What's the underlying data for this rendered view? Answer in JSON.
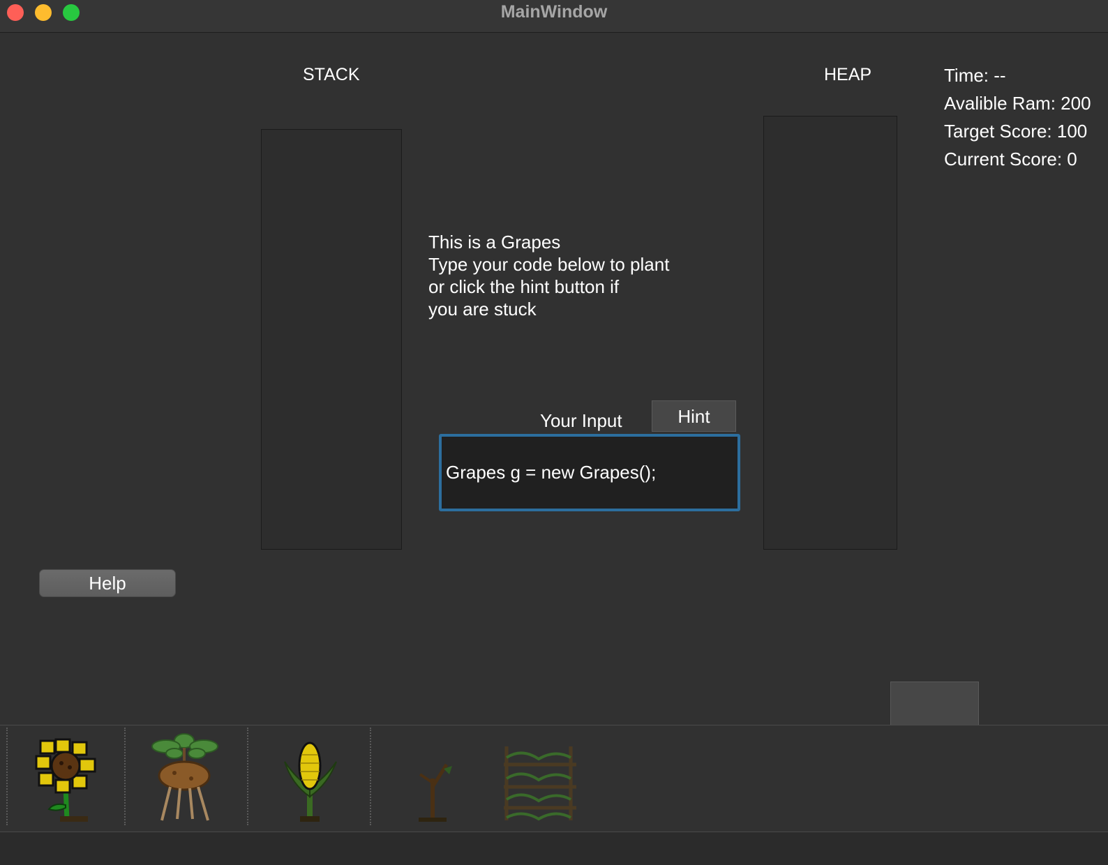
{
  "window": {
    "title": "MainWindow"
  },
  "labels": {
    "stack": "STACK",
    "heap": "HEAP",
    "your_input": "Your Input"
  },
  "stats": {
    "time": "Time: --",
    "ram": "Avalible Ram: 200",
    "target": "Target Score: 100",
    "current": "Current Score: 0"
  },
  "message": {
    "lines": [
      "This is a Grapes",
      "Type your code below to plant",
      "or click the hint button if",
      "you are stuck"
    ]
  },
  "buttons": {
    "hint": "Hint",
    "help": "Help"
  },
  "input": {
    "value": "Grapes g = new Grapes();"
  },
  "plants": [
    {
      "icon": "sunflower-icon"
    },
    {
      "icon": "potato-icon"
    },
    {
      "icon": "corn-icon"
    },
    {
      "icon": "sapling-icon"
    },
    {
      "icon": "grapes-vine-icon"
    }
  ],
  "colors": {
    "background": "#313131",
    "input_border": "#2c6e9e",
    "input_bg": "#202020"
  }
}
